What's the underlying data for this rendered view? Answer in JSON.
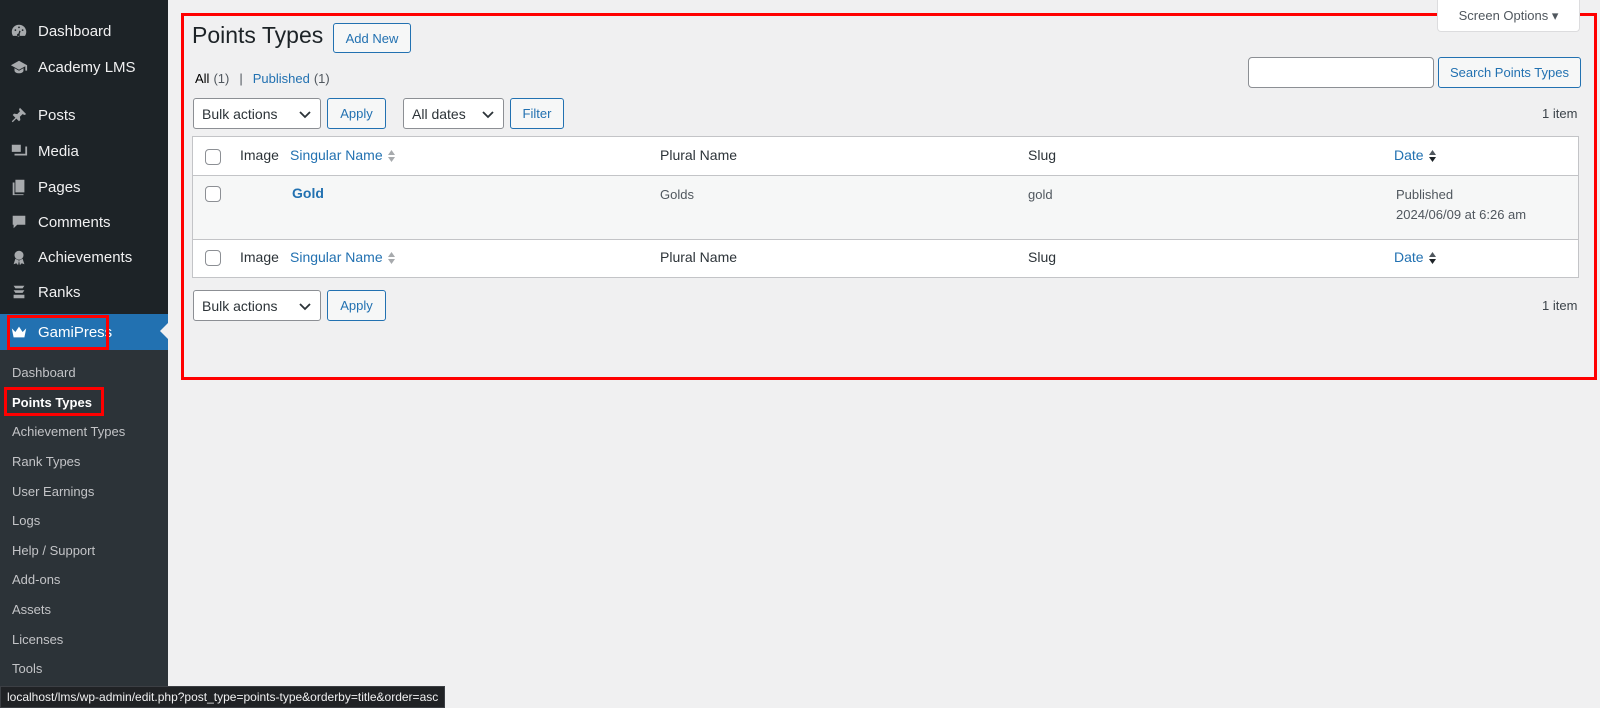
{
  "sidebar": {
    "items": [
      {
        "label": "Dashboard",
        "icon": "dashboard-icon"
      },
      {
        "label": "Academy LMS",
        "icon": "graduation-cap-icon"
      },
      {
        "label": "Posts",
        "icon": "pin-icon"
      },
      {
        "label": "Media",
        "icon": "media-icon"
      },
      {
        "label": "Pages",
        "icon": "pages-icon"
      },
      {
        "label": "Comments",
        "icon": "comment-icon"
      },
      {
        "label": "Achievements",
        "icon": "award-icon"
      },
      {
        "label": "Ranks",
        "icon": "ranks-icon"
      },
      {
        "label": "GamiPress",
        "icon": "crown-icon"
      }
    ],
    "submenu": [
      "Dashboard",
      "Points Types",
      "Achievement Types",
      "Rank Types",
      "User Earnings",
      "Logs",
      "Help / Support",
      "Add-ons",
      "Assets",
      "Licenses",
      "Tools"
    ]
  },
  "header": {
    "title": "Points Types",
    "add_new_label": "Add New",
    "screen_options_label": "Screen Options"
  },
  "views": {
    "all_label": "All",
    "all_count": "(1)",
    "separator": "|",
    "published_label": "Published",
    "published_count": "(1)"
  },
  "search": {
    "value": "",
    "button_label": "Search Points Types"
  },
  "tablenav_top": {
    "bulk_actions": "Bulk actions",
    "apply_label": "Apply",
    "dates_filter": "All dates",
    "filter_label": "Filter",
    "items_count": "1 item"
  },
  "table": {
    "columns": [
      "Image",
      "Singular Name",
      "Plural Name",
      "Slug",
      "Date"
    ],
    "rows": [
      {
        "singular_name": "Gold",
        "plural_name": "Golds",
        "slug": "gold",
        "status": "Published",
        "date": "2024/06/09 at 6:26 am"
      }
    ]
  },
  "tablenav_bottom": {
    "bulk_actions": "Bulk actions",
    "apply_label": "Apply",
    "items_count": "1 item"
  },
  "statusbar": {
    "url": "localhost/lms/wp-admin/edit.php?post_type=points-type&orderby=title&order=asc"
  },
  "colors": {
    "sidebar_bg": "#1d2327",
    "accent": "#2271b1",
    "highlight": "#ff0000"
  }
}
